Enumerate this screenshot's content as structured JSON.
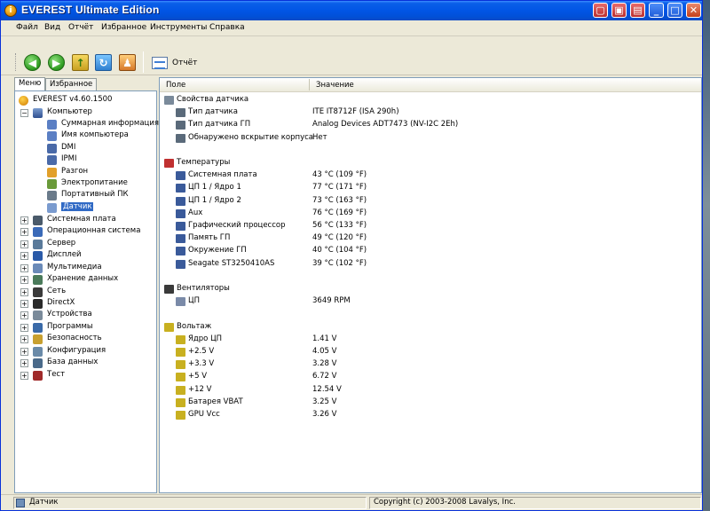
{
  "window": {
    "title": "EVEREST Ultimate Edition"
  },
  "menu": [
    "Файл",
    "Вид",
    "Отчёт",
    "Избранное",
    "Инструменты",
    "Справка"
  ],
  "toolbar": {
    "report_label": "Отчёт"
  },
  "tabs": {
    "menu": "Меню",
    "favorites": "Избранное"
  },
  "tree": {
    "root": "EVEREST v4.60.1500",
    "computer": "Компьютер",
    "computer_children": [
      "Суммарная информация",
      "Имя компьютера",
      "DMI",
      "IPMI",
      "Разгон",
      "Электропитание",
      "Портативный ПК",
      "Датчик"
    ],
    "sections": [
      "Системная плата",
      "Операционная система",
      "Сервер",
      "Дисплей",
      "Мультимедиа",
      "Хранение данных",
      "Сеть",
      "DirectX",
      "Устройства",
      "Программы",
      "Безопасность",
      "Конфигурация",
      "База данных",
      "Тест"
    ]
  },
  "columns": {
    "field": "Поле",
    "value": "Значение"
  },
  "groups": [
    {
      "title": "Свойства датчика",
      "rows": [
        {
          "name": "Тип датчика",
          "value": "ITE IT8712F  (ISA 290h)"
        },
        {
          "name": "Тип датчика ГП",
          "value": "Analog Devices ADT7473  (NV-I2C 2Eh)"
        },
        {
          "name": "Обнаружено вскрытие корпуса",
          "value": "Нет"
        }
      ]
    },
    {
      "title": "Температуры",
      "rows": [
        {
          "name": "Системная плата",
          "value": "43 °C  (109 °F)"
        },
        {
          "name": "ЦП 1 / Ядро 1",
          "value": "77 °C  (171 °F)"
        },
        {
          "name": "ЦП 1 / Ядро 2",
          "value": "73 °C  (163 °F)"
        },
        {
          "name": "Aux",
          "value": "76 °C  (169 °F)"
        },
        {
          "name": "Графический процессор",
          "value": "56 °C  (133 °F)"
        },
        {
          "name": "Память ГП",
          "value": "49 °C  (120 °F)"
        },
        {
          "name": "Окружение ГП",
          "value": "40 °C  (104 °F)"
        },
        {
          "name": "Seagate ST3250410AS",
          "value": "39 °C  (102 °F)"
        }
      ]
    },
    {
      "title": "Вентиляторы",
      "rows": [
        {
          "name": "ЦП",
          "value": "3649 RPM"
        }
      ]
    },
    {
      "title": "Вольтаж",
      "rows": [
        {
          "name": "Ядро ЦП",
          "value": "1.41 V"
        },
        {
          "name": "+2.5 V",
          "value": "4.05 V"
        },
        {
          "name": "+3.3 V",
          "value": "3.28 V"
        },
        {
          "name": "+5 V",
          "value": "6.72 V"
        },
        {
          "name": "+12 V",
          "value": "12.54 V"
        },
        {
          "name": "Батарея VBAT",
          "value": "3.25 V"
        },
        {
          "name": "GPU Vcc",
          "value": "3.26 V"
        }
      ]
    }
  ],
  "status": {
    "left": "Датчик",
    "right": "Copyright (c) 2003-2008 Lavalys, Inc."
  }
}
